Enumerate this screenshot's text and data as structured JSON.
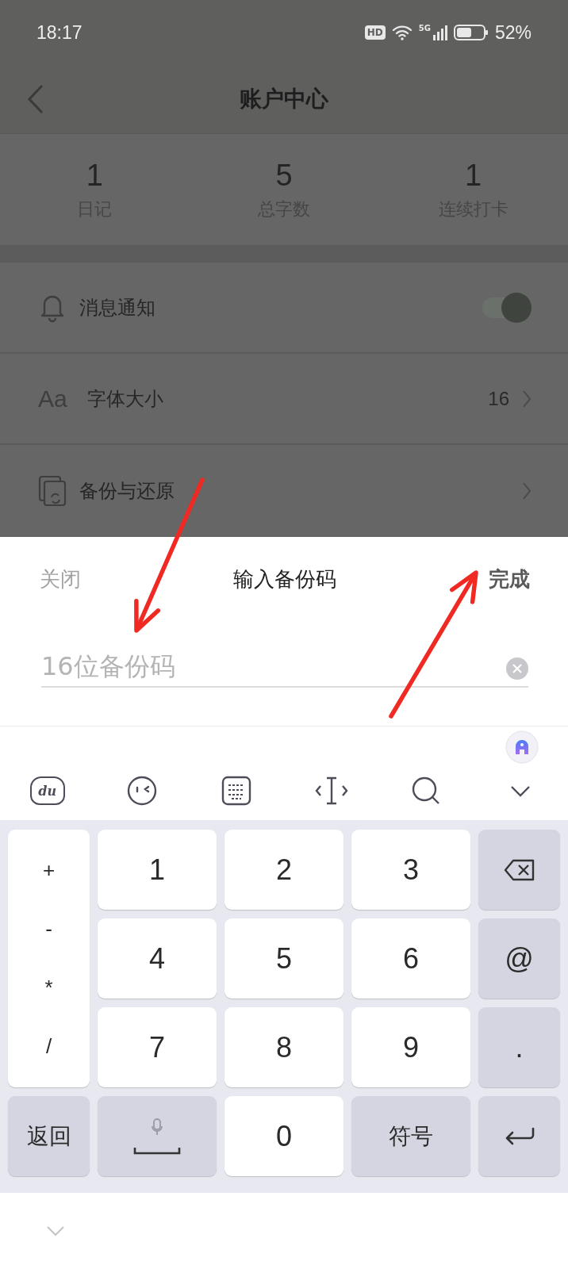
{
  "status_bar": {
    "time": "18:17",
    "hd_badge": "HD",
    "network": "5G",
    "battery": "52%"
  },
  "header": {
    "title": "账户中心"
  },
  "stats": [
    {
      "value": "1",
      "label": "日记"
    },
    {
      "value": "5",
      "label": "总字数"
    },
    {
      "value": "1",
      "label": "连续打卡"
    }
  ],
  "settings": [
    {
      "kind": "toggle",
      "label": "消息通知",
      "on": true
    },
    {
      "kind": "value",
      "icon_text": "Aa",
      "label": "字体大小",
      "value": "16"
    },
    {
      "kind": "link",
      "label": "备份与还原"
    }
  ],
  "dialog": {
    "close": "关闭",
    "title": "输入备份码",
    "done": "完成",
    "input": {
      "placeholder": "16位备份码"
    }
  },
  "keyboard_toolbar": [
    {
      "kind": "bear",
      "label": "du"
    },
    {
      "kind": "emoji"
    },
    {
      "kind": "keyboard"
    },
    {
      "kind": "cursor"
    },
    {
      "kind": "search"
    },
    {
      "kind": "collapse"
    }
  ],
  "keys": [
    {
      "kind": "symbols",
      "labels": [
        "+",
        "-",
        "*",
        "/"
      ]
    },
    {
      "kind": "digit",
      "label": "1"
    },
    {
      "kind": "digit",
      "label": "2"
    },
    {
      "kind": "digit",
      "label": "3"
    },
    {
      "kind": "backspace"
    },
    {
      "kind": "digit",
      "label": "4"
    },
    {
      "kind": "digit",
      "label": "5"
    },
    {
      "kind": "digit",
      "label": "6"
    },
    {
      "kind": "function",
      "label": "@"
    },
    {
      "kind": "digit",
      "label": "7"
    },
    {
      "kind": "digit",
      "label": "8"
    },
    {
      "kind": "digit",
      "label": "9"
    },
    {
      "kind": "function",
      "label": "."
    },
    {
      "kind": "function",
      "label": "返回"
    },
    {
      "kind": "space"
    },
    {
      "kind": "digit",
      "label": "0"
    },
    {
      "kind": "function",
      "label": "符号"
    },
    {
      "kind": "enter"
    }
  ],
  "annotations": [
    {
      "kind": "arrow"
    },
    {
      "kind": "arrow"
    }
  ]
}
